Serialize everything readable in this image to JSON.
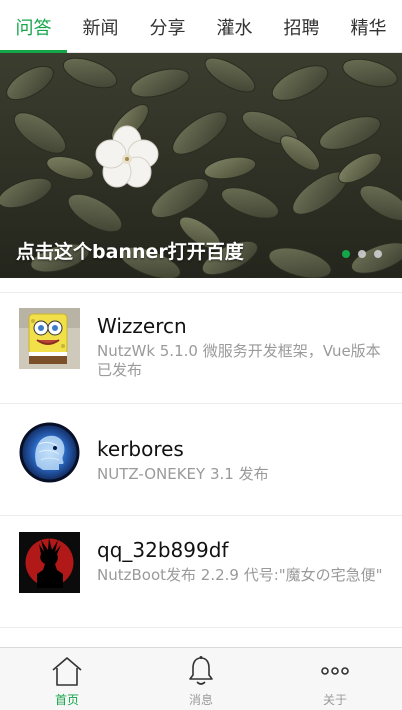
{
  "tabs": [
    {
      "label": "问答",
      "active": true
    },
    {
      "label": "新闻",
      "active": false
    },
    {
      "label": "分享",
      "active": false
    },
    {
      "label": "灌水",
      "active": false
    },
    {
      "label": "招聘",
      "active": false
    },
    {
      "label": "精华",
      "active": false
    }
  ],
  "banner": {
    "text": "点击这个banner打开百度",
    "dot_count": 3,
    "active_dot": 1
  },
  "list": [
    {
      "title": "Wizzercn",
      "subtitle": "NutzWk 5.1.0 微服务开发框架，Vue版本已发布",
      "avatar_icon": "spongebob-avatar"
    },
    {
      "title": "kerbores",
      "subtitle": "NUTZ-ONEKEY 3.1 发布",
      "avatar_icon": "blue-head-avatar"
    },
    {
      "title": "qq_32b899df",
      "subtitle": "NutzBoot发布 2.2.9 代号:\"魔女の宅急便\"",
      "avatar_icon": "goku-silhouette-avatar"
    }
  ],
  "bottom_nav": [
    {
      "label": "首页",
      "icon": "home-icon",
      "active": true
    },
    {
      "label": "消息",
      "icon": "bell-icon",
      "active": false
    },
    {
      "label": "关于",
      "icon": "more-icon",
      "active": false
    }
  ],
  "colors": {
    "accent": "#15a64a",
    "muted": "#9a9a9a"
  }
}
